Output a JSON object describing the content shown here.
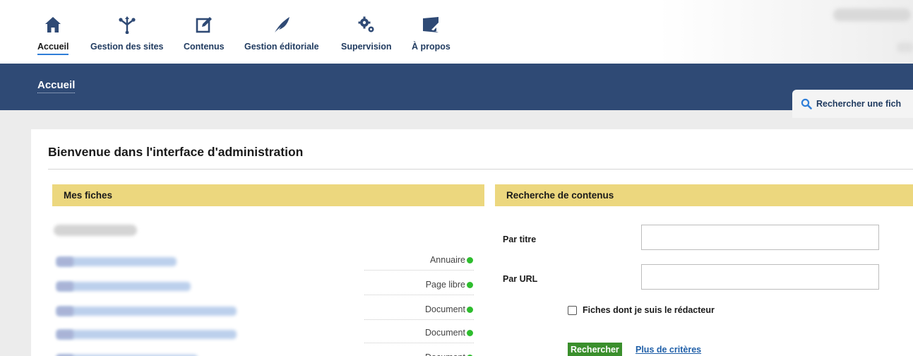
{
  "nav": {
    "items": [
      {
        "label": "Accueil",
        "icon": "home-icon",
        "active": true
      },
      {
        "label": "Gestion des sites",
        "icon": "sitemap-icon",
        "active": false
      },
      {
        "label": "Contenus",
        "icon": "edit-icon",
        "active": false
      },
      {
        "label": "Gestion éditoriale",
        "icon": "feather-icon",
        "active": false
      },
      {
        "label": "Supervision",
        "icon": "gears-icon",
        "active": false
      },
      {
        "label": "À propos",
        "icon": "about-icon",
        "active": false
      }
    ],
    "icon_color": "#2f4a75",
    "active_underline_color": "#2f7ed8"
  },
  "bluebar": {
    "title": "Accueil",
    "color": "#2f4a75"
  },
  "search_tab": {
    "label": "Rechercher une fich",
    "icon": "search-icon"
  },
  "main": {
    "title": "Bienvenue dans l'interface d'administration",
    "left_section": {
      "heading": "Mes fiches",
      "rows": [
        {
          "type": "Annuaire",
          "status_color": "#2ebd2e"
        },
        {
          "type": "Page libre",
          "status_color": "#2ebd2e"
        },
        {
          "type": "Document",
          "status_color": "#2ebd2e"
        },
        {
          "type": "Document",
          "status_color": "#2ebd2e"
        },
        {
          "type": "Document",
          "status_color": "#2ebd2e"
        }
      ]
    },
    "right_section": {
      "heading": "Recherche de contenus",
      "title_label": "Par titre",
      "title_value": "",
      "url_label": "Par URL",
      "url_value": "",
      "checkbox_label": "Fiches dont je suis le rédacteur",
      "checkbox_checked": false,
      "search_button": "Rechercher",
      "more_link": "Plus de critères"
    },
    "section_header_color": "#ecd77e"
  }
}
